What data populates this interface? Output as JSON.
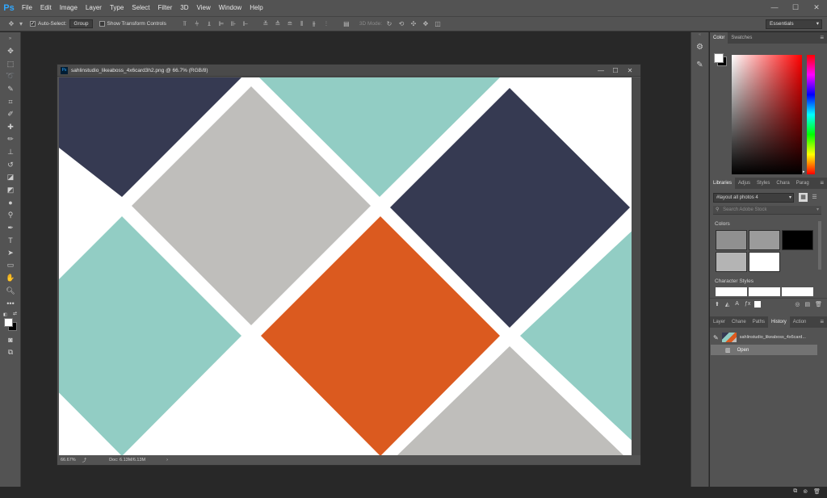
{
  "app": {
    "logo": "Ps"
  },
  "menu": [
    "File",
    "Edit",
    "Image",
    "Layer",
    "Type",
    "Select",
    "Filter",
    "3D",
    "View",
    "Window",
    "Help"
  ],
  "window_controls": [
    "—",
    "☐",
    "✕"
  ],
  "options": {
    "auto_select_label": "Auto-Select:",
    "auto_select_checked": true,
    "group_value": "Group",
    "show_transform_label": "Show Transform Controls",
    "mode_3d_label": "3D Mode:",
    "workspace": "Essentials"
  },
  "tools": [
    "move-tool",
    "marquee-tool",
    "lasso-tool",
    "quick-select-tool",
    "crop-tool",
    "eyedropper-tool",
    "healing-brush-tool",
    "brush-tool",
    "clone-stamp-tool",
    "history-brush-tool",
    "eraser-tool",
    "paint-bucket-tool",
    "blur-tool",
    "dodge-tool",
    "pen-tool",
    "type-tool",
    "path-select-tool",
    "rectangle-tool",
    "hand-tool",
    "zoom-tool",
    "more-tools"
  ],
  "document": {
    "title": "sahlinstudio_likeaboss_4x6card3h2.png @ 66.7% (RGB/8)",
    "zoom": "66.67%",
    "doc_size": "Doc: 6.13M/6.13M",
    "colors": {
      "navy": "#363a52",
      "grey": "#bfbebb",
      "teal": "#92cdc4",
      "orange": "#db5a1f"
    }
  },
  "color_panel": {
    "tabs": [
      "Color",
      "Swatches"
    ]
  },
  "libraries_panel": {
    "tabs": [
      "Libraries",
      "Adjus",
      "Styles",
      "Chara",
      "Parag"
    ],
    "library_name": "#layout all photos 4",
    "search_placeholder": "Search Adobe Stock",
    "colors_label": "Colors",
    "swatches": [
      "#909090",
      "#9b9b9b",
      "#000000",
      "#b4b4b4",
      "#ffffff"
    ],
    "character_styles_label": "Character Styles"
  },
  "history_panel": {
    "tabs": [
      "Layer",
      "Chane",
      "Paths",
      "History",
      "Action"
    ],
    "snapshot_name": "sahlinstudio_likeaboss_4x6card...",
    "steps": [
      "Open"
    ]
  }
}
